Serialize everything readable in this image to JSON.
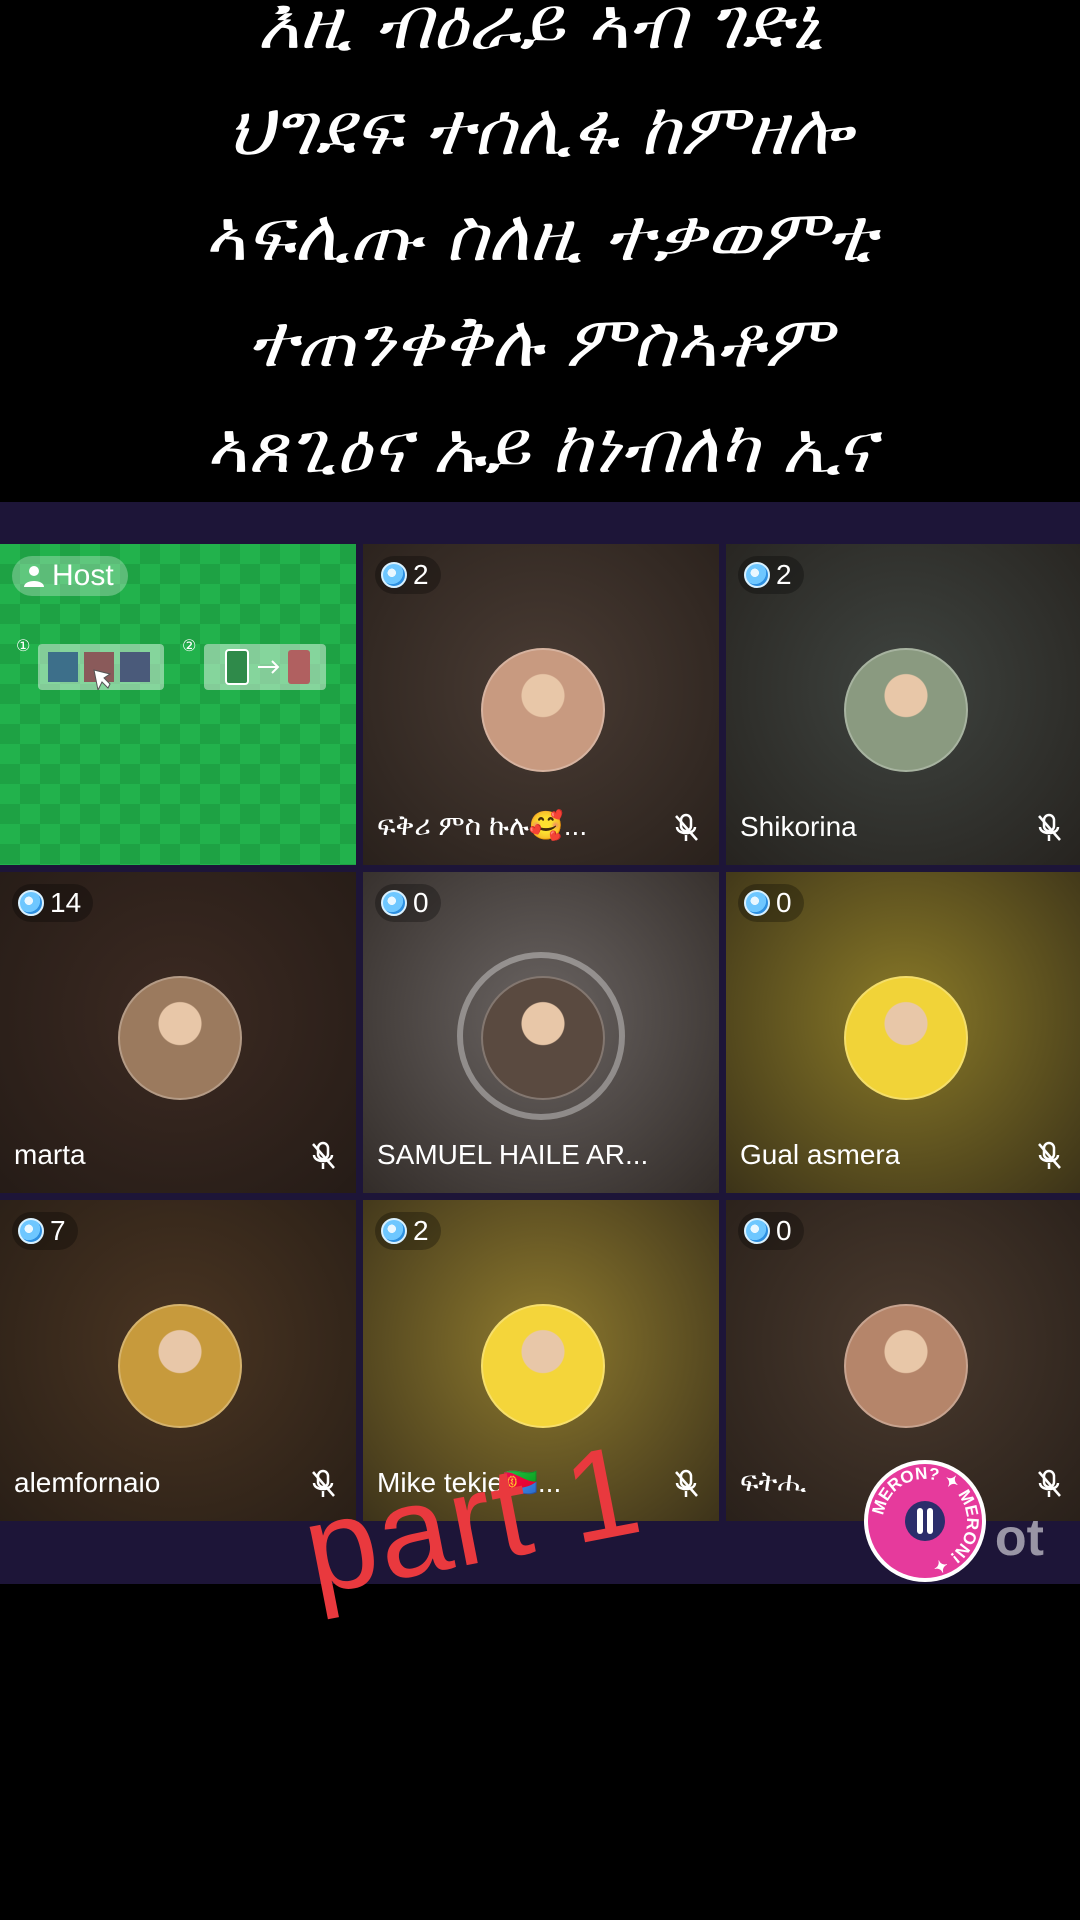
{
  "caption": {
    "lines": [
      "እዚ ብዕራይ ኣብ ገድኒ",
      "ህግደፍ ተሰሊፋ ከምዘሎ",
      "ኣፍሊጡ ስለዚ ተቃወምቲ",
      "ተጠንቀቅሉ ምስኣቶም",
      "ኣጸጊዕና ኡይ ከነብለካ ኢና"
    ]
  },
  "host_tile": {
    "label": "Host",
    "steps": [
      "①",
      "②"
    ]
  },
  "participants": [
    {
      "name": "ፍቅሪ ምስ ኩሉ🥰...",
      "count": "2",
      "muted": true,
      "bg": "#4a3c34",
      "avatar": "#c89a80"
    },
    {
      "name": "Shikorina",
      "count": "2",
      "muted": true,
      "bg": "#3f4440",
      "avatar": "#8a9a80"
    },
    {
      "name": "marta",
      "count": "14",
      "muted": true,
      "bg": "#3c2a22",
      "avatar": "#9b7a5e"
    },
    {
      "name": "SAMUEL HAILE AR...",
      "count": "0",
      "muted": false,
      "bg": "#6a6462",
      "avatar": "#5a4a40"
    },
    {
      "name": "Gual asmera",
      "count": "0",
      "muted": true,
      "bg": "#8a7a28",
      "avatar": "#f1d338"
    },
    {
      "name": "alemfornaio",
      "count": "7",
      "muted": true,
      "bg": "#4a3522",
      "avatar": "#c79a3c"
    },
    {
      "name": "Mike tekie🇪🇷...",
      "count": "2",
      "muted": true,
      "bg": "#8e7a2e",
      "avatar": "#f4d53a"
    },
    {
      "name": "ፍትሒ",
      "count": "0",
      "muted": true,
      "bg": "#4a3a2e",
      "avatar": "#b5856a"
    }
  ],
  "overlay": {
    "part_label": "part 1",
    "watermark": "ot",
    "stamp_text": "MERON? MERON!"
  },
  "colors": {
    "band": "#1d1538",
    "part_label": "#e9393e",
    "stamp": "#e63a9c",
    "host_green": "#22b24c"
  }
}
